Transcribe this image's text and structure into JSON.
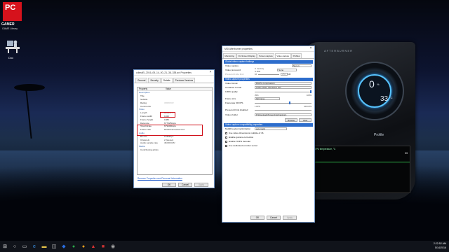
{
  "desktop": {
    "pcgamer_logo": "PC GAMER",
    "pcgamer_label": "GAMER",
    "pcgamer_sub": "GAME Library",
    "doc_label": "Doc"
  },
  "props_window": {
    "title": "cdimaEl_2016_05_14_00_21_38_338.avi Properties",
    "tabs": [
      "General",
      "Security",
      "Details",
      "Previous Versions"
    ],
    "active_tab": "Details",
    "header": [
      "Property",
      "Value"
    ],
    "rows": [
      {
        "k": "Description",
        "v": "",
        "sec": true
      },
      {
        "k": "Title",
        "v": ""
      },
      {
        "k": "Subtitle",
        "v": ""
      },
      {
        "k": "Rating",
        "v": "☆☆☆☆☆"
      },
      {
        "k": "Comments",
        "v": ""
      },
      {
        "k": "Video",
        "v": "",
        "sec": true
      },
      {
        "k": "Length",
        "v": "00:01:17"
      },
      {
        "k": "Frame width",
        "v": "1920"
      },
      {
        "k": "Frame height",
        "v": "1080"
      },
      {
        "k": "Data rate",
        "v": "677925kbps"
      },
      {
        "k": "Total bitrate",
        "v": "679409kbps"
      },
      {
        "k": "Frame rate",
        "v": "60.00 frames/second"
      },
      {
        "k": "Audio",
        "v": "",
        "sec": true
      },
      {
        "k": "Bit rate",
        "v": "1536kbps"
      },
      {
        "k": "Channels",
        "v": "2 (stereo)"
      },
      {
        "k": "Audio sample rate",
        "v": "48.000 kHz"
      },
      {
        "k": "Media",
        "v": "",
        "sec": true
      },
      {
        "k": "Contributing artists",
        "v": ""
      }
    ],
    "link": "Remove Properties and Personal Information",
    "buttons": [
      "OK",
      "Cancel",
      "Apply"
    ]
  },
  "ab_window": {
    "title": "MSI Afterburner properties",
    "tabs": [
      "Monitoring",
      "On-Screen Display",
      "Screen capture",
      "Video capture",
      "Profiles"
    ],
    "global_section": "Global video capture hotkeys",
    "video_capture_label": "Video capture",
    "video_capture_key": "Num 1",
    "prerecord_label": "Video prerecord",
    "prerecord_key": "None",
    "prerecord_in_memory": "in memory",
    "prerecord_to_disk": "to disk",
    "prerecord_limit": "Prerecord size limit",
    "prerecord_sizes": [
      "10",
      "256",
      "MB"
    ],
    "props_section": "Video capture properties",
    "video_format_label": "Video format",
    "video_format_value": "RGPG compression",
    "container_label": "Container format",
    "container_value": "Audio Video Interleave AVI",
    "quality_label": "100% quality",
    "quality_pcts": [
      "25%",
      "100%"
    ],
    "frame_size_label": "Frame size",
    "frame_size_value": "full frame",
    "framerate_label": "Framerate 60 FPS",
    "fps_marks": [
      "1 FPS",
      "100 FPS"
    ],
    "prerecord_limit2": "Prerecord limit disabled",
    "folder_label": "Videos folder",
    "folder_value": "D:\\Downloads\\Screenshots\\Captures\\",
    "browse_btn": "Browse",
    "view_btn": "View",
    "compat_section": "Video capture compatibility properties",
    "multithread_label": "Multithreaded optimization",
    "multithread_value": "automatic",
    "checks": [
      "Use video dimensions multiple of 16",
      "Enable gamma correction",
      "Enable NVPG decoder",
      "Use dedicated encoder server"
    ],
    "buttons": [
      "OK",
      "Cancel",
      "Apply"
    ]
  },
  "skin": {
    "brand": "AFTERBURNER",
    "gauge_value": "0",
    "gauge_unit": "%",
    "temp_value": "33",
    "temp_unit": "°C",
    "profile": "Profile",
    "graph_label": "GPU temperature, °C",
    "graph_value": "33"
  },
  "taskbar": {
    "time": "2:22:52 AM",
    "date": "5/14/2016"
  }
}
